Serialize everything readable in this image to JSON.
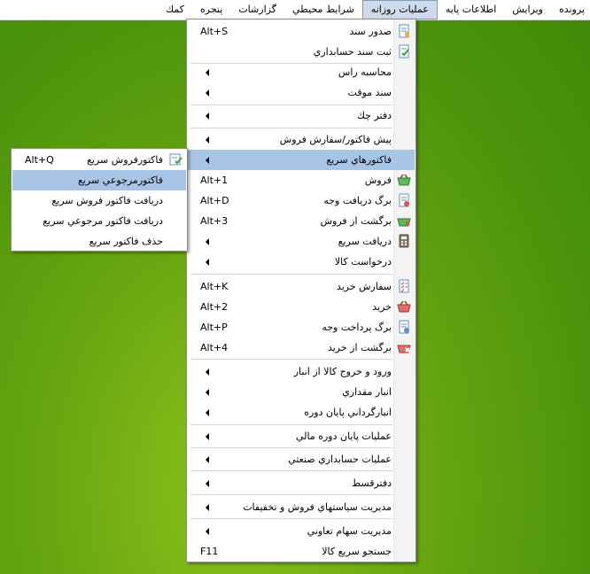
{
  "menubar": {
    "items": [
      "پرونده",
      "ويرايش",
      "اطلاعات پايه",
      "عمليات روزانه",
      "شرايط محيطي",
      "گزارشات",
      "پنجره",
      "كمك"
    ],
    "active": "عمليات روزانه"
  },
  "main_menu": {
    "items": [
      {
        "label": "صدور سند",
        "shortcut": "Alt+S",
        "icon": "document-icon"
      },
      {
        "label": "ثبت سند حسابداري",
        "shortcut": "",
        "icon": "document-check-icon"
      },
      {
        "label": "محاسبه راس",
        "submenu": true
      },
      {
        "label": "سند موقت",
        "submenu": true
      },
      {
        "label": "دفتر چك",
        "submenu": true
      },
      {
        "label": "پيش فاكتور/سفارش فروش",
        "submenu": true
      },
      {
        "label": "فاكتورهاي سريع",
        "submenu": true,
        "highlighted": true
      },
      {
        "label": "فروش",
        "shortcut": "Alt+1",
        "icon": "basket-green-icon"
      },
      {
        "label": "برگ دريافت وجه",
        "shortcut": "Alt+D",
        "icon": "receipt-icon"
      },
      {
        "label": "برگشت از فروش",
        "shortcut": "Alt+3",
        "icon": "basket-return-icon"
      },
      {
        "label": "دريافت سريع",
        "submenu": true,
        "icon": "calculator-icon"
      },
      {
        "label": "درخواست كالا",
        "submenu": true
      },
      {
        "label": "سفارش خريد",
        "shortcut": "Alt+K",
        "icon": "checklist-icon"
      },
      {
        "label": "خريد",
        "shortcut": "Alt+2",
        "icon": "basket-red-icon"
      },
      {
        "label": "برگ پرداخت وجه",
        "shortcut": "Alt+P",
        "icon": "payment-icon"
      },
      {
        "label": "برگشت از خريد",
        "shortcut": "Alt+4",
        "icon": "basket-red-return-icon"
      },
      {
        "label": "ورود و خروج كالا از انبار",
        "submenu": true
      },
      {
        "label": "انبار مقداري",
        "submenu": true
      },
      {
        "label": "انبارگرداني پايان دوره",
        "submenu": true
      },
      {
        "label": "عمليات پايان دوره مالي",
        "submenu": true
      },
      {
        "label": "عمليات حسابداري صنعتي",
        "submenu": true
      },
      {
        "label": "دفترقسط",
        "submenu": true
      },
      {
        "label": "مديريت سياستهاي فروش و تخفيفات",
        "submenu": true
      },
      {
        "label": "مديريت سهام تعاوني",
        "submenu": true
      },
      {
        "label": "جستجو سريع كالا",
        "shortcut": "F11"
      }
    ]
  },
  "sub_menu": {
    "items": [
      {
        "label": "فاكتورفروش سريع",
        "shortcut": "Alt+Q",
        "icon": "invoice-check-icon"
      },
      {
        "label": "فاكتورمرجوعي سريع",
        "highlighted": true
      },
      {
        "label": "دريافت فاكتور فروش سريع"
      },
      {
        "label": "دريافت فاكتور مرجوعي سريع"
      },
      {
        "label": "حذف فاكتور سريع"
      }
    ]
  }
}
